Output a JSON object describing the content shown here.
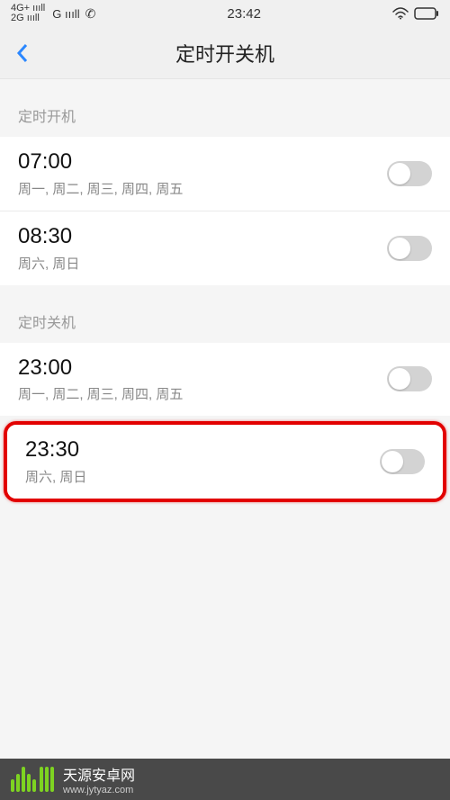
{
  "statusBar": {
    "network1": "4G+",
    "network2": "2G",
    "network3": "G",
    "time": "23:42"
  },
  "nav": {
    "title": "定时开关机"
  },
  "sections": [
    {
      "header": "定时开机",
      "rows": [
        {
          "time": "07:00",
          "days": "周一, 周二, 周三, 周四, 周五",
          "on": false
        },
        {
          "time": "08:30",
          "days": "周六, 周日",
          "on": false
        }
      ]
    },
    {
      "header": "定时关机",
      "rows": [
        {
          "time": "23:00",
          "days": "周一, 周二, 周三, 周四, 周五",
          "on": false
        },
        {
          "time": "23:30",
          "days": "周六, 周日",
          "on": false,
          "highlighted": true
        }
      ]
    }
  ],
  "watermark": {
    "title": "天源安卓网",
    "url": "www.jytyaz.com"
  }
}
